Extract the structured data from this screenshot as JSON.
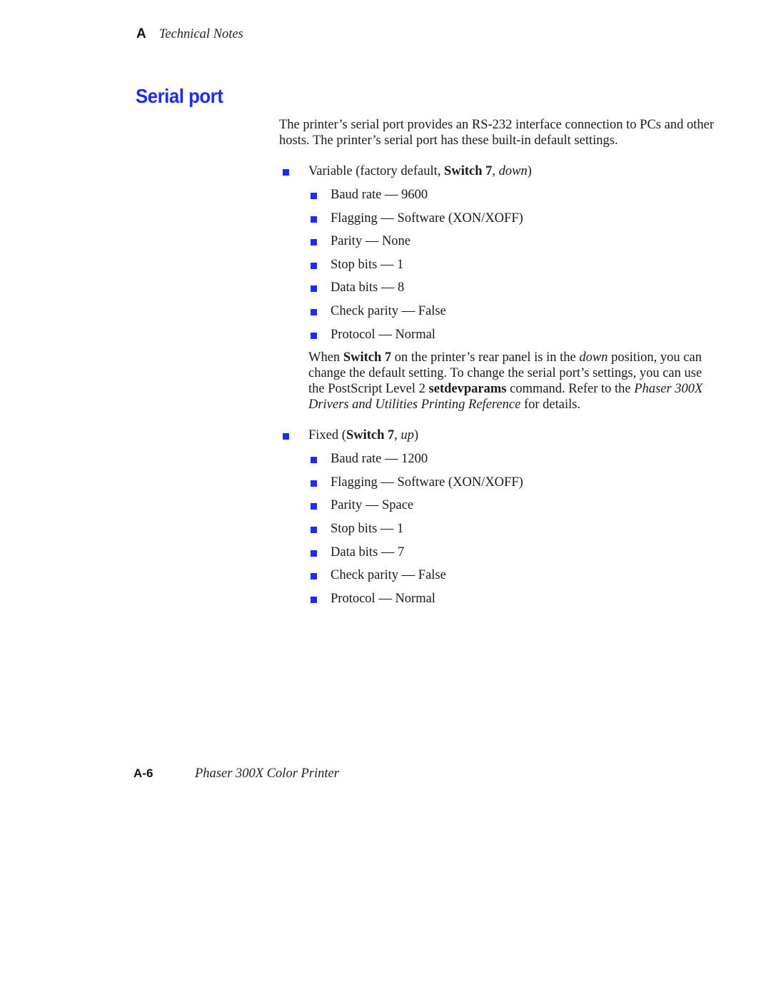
{
  "header": {
    "chapter_letter": "A",
    "chapter_title": "Technical Notes"
  },
  "section": {
    "title": "Serial port"
  },
  "intro": "The printer’s serial port provides an RS-232 interface connection to PCs and other hosts.  The printer’s serial port has these built-in default settings.",
  "variable": {
    "label_pre": "Variable (factory default, ",
    "label_bold": "Switch 7",
    "label_mid": ", ",
    "label_italic": "down",
    "label_post": ")",
    "items": [
      "Baud rate — 9600",
      "Flagging — Software (XON/XOFF)",
      "Parity — None",
      "Stop bits — 1",
      "Data bits — 8",
      "Check parity — False",
      "Protocol — Normal"
    ],
    "note": {
      "p1": "When ",
      "b1": "Switch 7",
      "p2": " on the printer’s rear panel is in the ",
      "i1": "down",
      "p3": " position, you can change the default setting.  To change the serial port’s settings, you can use the PostScript Level 2 ",
      "b2": "setdevparams",
      "p4": " command.  Refer to the ",
      "i2": "Phaser 300X Drivers and Utilities Printing Reference",
      "p5": " for details."
    }
  },
  "fixed": {
    "label_pre": "Fixed (",
    "label_bold": "Switch 7",
    "label_mid": ", ",
    "label_italic": "up",
    "label_post": ")",
    "items": [
      "Baud rate — 1200",
      "Flagging — Software (XON/XOFF)",
      "Parity — Space",
      "Stop bits — 1",
      "Data bits — 7",
      "Check parity — False",
      "Protocol — Normal"
    ]
  },
  "footer": {
    "page_number": "A-6",
    "product": "Phaser 300X Color Printer"
  },
  "colors": {
    "accent": "#1f2bf0"
  }
}
